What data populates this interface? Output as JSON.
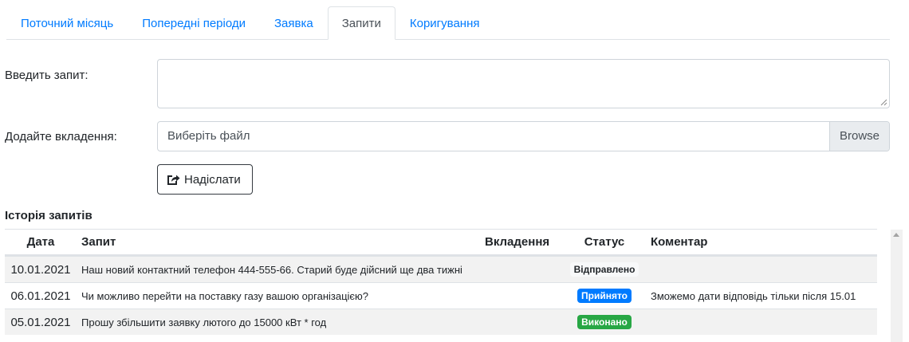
{
  "tabs": [
    {
      "label": "Поточний місяць",
      "active": false
    },
    {
      "label": "Попередні періоди",
      "active": false
    },
    {
      "label": "Заявка",
      "active": false
    },
    {
      "label": "Запити",
      "active": true
    },
    {
      "label": "Коригування",
      "active": false
    }
  ],
  "form": {
    "request_label": "Введить запит:",
    "request_value": "",
    "attach_label": "Додайте вкладення:",
    "file_placeholder": "Виберіть файл",
    "browse_label": "Browse",
    "send_label": "Надіслати"
  },
  "history": {
    "title": "Історія запитів",
    "columns": {
      "date": "Дата",
      "request": "Запит",
      "attachments": "Вкладення",
      "status": "Статус",
      "comment": "Коментар"
    },
    "rows": [
      {
        "date": "10.01.2021",
        "request": "Наш новий контактний телефон 444-555-66. Старий буде дійсний ще два тижні",
        "attachment": "",
        "status": "Відправлено",
        "status_color": "#f8f9fa",
        "status_text_color": "#212529",
        "comment": ""
      },
      {
        "date": "06.01.2021",
        "request": "Чи можливо перейти на поставку газу вашою організацією?",
        "attachment": "",
        "status": "Прийнято",
        "status_color": "#007bff",
        "status_text_color": "#ffffff",
        "comment": "Зможемо дати відповідь тільки після 15.01"
      },
      {
        "date": "05.01.2021",
        "request": "Прошу збільшити заявку лютого до 15000 кВт * год",
        "attachment": "",
        "status": "Виконано",
        "status_color": "#28a745",
        "status_text_color": "#ffffff",
        "comment": ""
      }
    ]
  },
  "colors": {
    "link": "#007bff",
    "border": "#dee2e6",
    "stripe": "#f2f2f2"
  }
}
